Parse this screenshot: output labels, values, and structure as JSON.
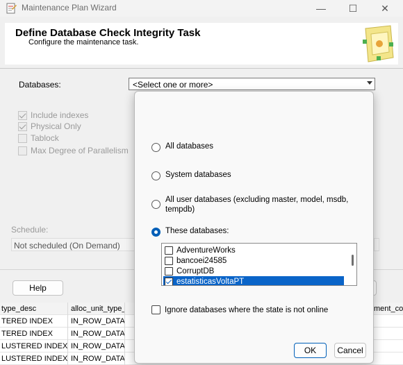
{
  "window": {
    "title": "Maintenance Plan Wizard",
    "minimize": "—",
    "maximize": "☐",
    "close": "✕"
  },
  "header": {
    "title": "Define Database Check Integrity Task",
    "subtitle": "Configure the maintenance task."
  },
  "form": {
    "databases_label": "Databases:",
    "databases_value": "<Select one or more>",
    "options": [
      {
        "label": "Include indexes",
        "checked": true
      },
      {
        "label": "Physical Only",
        "checked": true
      },
      {
        "label": "Tablock",
        "checked": false
      },
      {
        "label": "Max Degree of Parallelism",
        "checked": false
      }
    ],
    "schedule_label": "Schedule:",
    "schedule_value": "Not scheduled (On Demand)",
    "help_button": "Help"
  },
  "popup": {
    "radios": [
      {
        "label": "All databases",
        "selected": false
      },
      {
        "label": "System databases",
        "selected": false
      },
      {
        "label": "All user databases  (excluding master, model, msdb, tempdb)",
        "selected": false
      },
      {
        "label": "These databases:",
        "selected": true
      }
    ],
    "databases": [
      {
        "name": "AdventureWorks",
        "checked": false,
        "selected": false
      },
      {
        "name": "bancoei24585",
        "checked": false,
        "selected": false
      },
      {
        "name": "CorruptDB",
        "checked": false,
        "selected": false
      },
      {
        "name": "estatisticasVoltaPT",
        "checked": true,
        "selected": true
      }
    ],
    "ignore_offline_label": "Ignore databases where the state is not online",
    "ok_button": "OK",
    "cancel_button": "Cancel"
  },
  "background_grid": {
    "headers": [
      "type_desc",
      "alloc_unit_type_desc",
      "ment_cou"
    ],
    "rows": [
      [
        "TERED INDEX",
        "IN_ROW_DATA"
      ],
      [
        "TERED INDEX",
        "IN_ROW_DATA"
      ],
      [
        "LUSTERED INDEX",
        "IN_ROW_DATA"
      ],
      [
        "LUSTERED INDEX",
        "IN_ROW_DATA"
      ]
    ]
  },
  "colors": {
    "accent": "#005fb8",
    "selection": "#0a64c8",
    "disabled_text": "#9a9a9a"
  }
}
